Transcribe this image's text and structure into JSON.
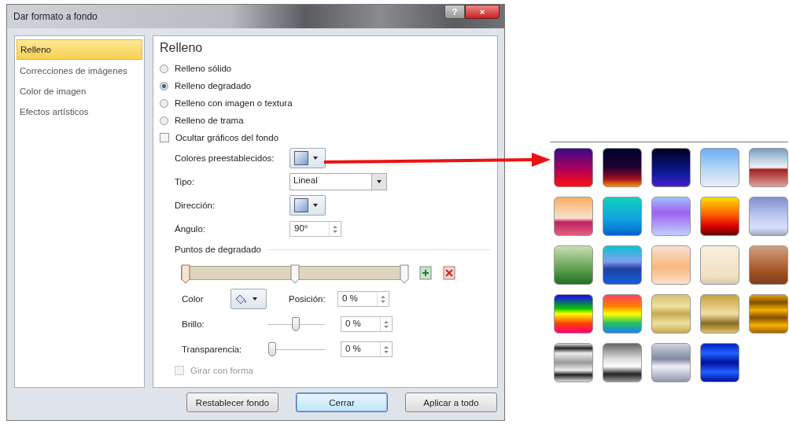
{
  "window": {
    "title": "Dar formato a fondo",
    "help_button": "?",
    "close_button": "×"
  },
  "sidebar": {
    "items": [
      {
        "label": "Relleno",
        "selected": true
      },
      {
        "label": "Correcciones de imágenes",
        "selected": false
      },
      {
        "label": "Color de imagen",
        "selected": false
      },
      {
        "label": "Efectos artísticos",
        "selected": false
      }
    ]
  },
  "panel": {
    "title": "Relleno",
    "fill_options": [
      {
        "label": "Relleno sólido",
        "selected": false
      },
      {
        "label": "Relleno degradado",
        "selected": true
      },
      {
        "label": "Relleno con imagen o textura",
        "selected": false
      },
      {
        "label": "Relleno de trama",
        "selected": false
      }
    ],
    "hide_graphics": {
      "label": "Ocultar gráficos del fondo",
      "checked": false
    },
    "preset_colors": {
      "label": "Colores preestablecidos:"
    },
    "type": {
      "label": "Tipo:",
      "value": "Lineal"
    },
    "direction": {
      "label": "Dirección:"
    },
    "angle": {
      "label": "Ángulo:",
      "value": "90°"
    },
    "gradient_stops": {
      "label": "Puntos de degradado",
      "stops": [
        {
          "level": 0,
          "selected": true
        },
        {
          "level": 0.5,
          "selected": false
        },
        {
          "level": 1,
          "selected": false
        }
      ]
    },
    "color": {
      "label": "Color"
    },
    "position": {
      "label": "Posición:",
      "value": "0 %"
    },
    "brightness": {
      "label": "Brillo:",
      "level": 0.5,
      "value": "0 %"
    },
    "transparency": {
      "label": "Transparencia:",
      "level": 0,
      "value": "0 %"
    },
    "rotate_with_shape": {
      "label": "Girar con forma",
      "checked": false,
      "disabled": true
    }
  },
  "buttons": [
    {
      "label": "Restablecer fondo",
      "selected": false
    },
    {
      "label": "Cerrar",
      "selected": true
    },
    {
      "label": "Aplicar a todo",
      "selected": false
    }
  ]
}
